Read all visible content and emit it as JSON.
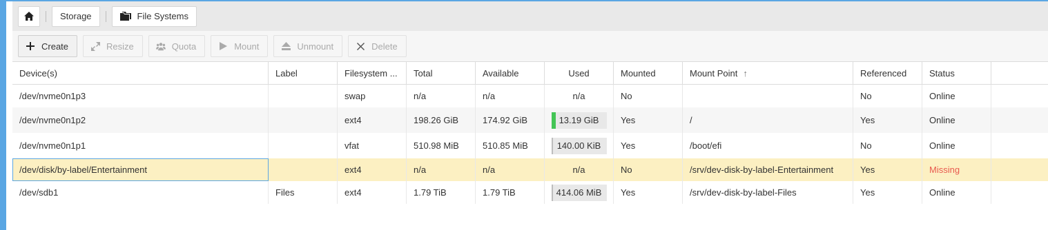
{
  "colors": {
    "accent": "#5aa6e3",
    "used_fill": "#44c556",
    "missing": "#e85a4f",
    "selected_row": "#fcf0c2"
  },
  "breadcrumb": {
    "home_icon": "home-icon",
    "items": [
      {
        "label": "Storage"
      },
      {
        "label": "File Systems",
        "icon": "folders-icon"
      }
    ]
  },
  "toolbar": {
    "buttons": [
      {
        "label": "Create",
        "icon": "plus-icon",
        "enabled": true
      },
      {
        "label": "Resize",
        "icon": "expand-icon",
        "enabled": false
      },
      {
        "label": "Quota",
        "icon": "users-icon",
        "enabled": false
      },
      {
        "label": "Mount",
        "icon": "play-icon",
        "enabled": false
      },
      {
        "label": "Unmount",
        "icon": "eject-icon",
        "enabled": false
      },
      {
        "label": "Delete",
        "icon": "x-icon",
        "enabled": false
      }
    ]
  },
  "table": {
    "columns": [
      "Device(s)",
      "Label",
      "Filesystem ...",
      "Total",
      "Available",
      "Used",
      "Mounted",
      "Mount Point",
      "Referenced",
      "Status"
    ],
    "sort_column": "Mount Point",
    "sort_direction": "ascending",
    "rows": [
      {
        "device": "/dev/nvme0n1p3",
        "label": "",
        "fs": "swap",
        "total": "n/a",
        "available": "n/a",
        "used": "n/a",
        "used_fraction": null,
        "mounted": "No",
        "mount_point": "",
        "referenced": "No",
        "status": "Online"
      },
      {
        "device": "/dev/nvme0n1p2",
        "label": "",
        "fs": "ext4",
        "total": "198.26 GiB",
        "available": "174.92 GiB",
        "used": "13.19 GiB",
        "used_fraction": 0.07,
        "mounted": "Yes",
        "mount_point": "/",
        "referenced": "Yes",
        "status": "Online"
      },
      {
        "device": "/dev/nvme0n1p1",
        "label": "",
        "fs": "vfat",
        "total": "510.98 MiB",
        "available": "510.85 MiB",
        "used": "140.00 KiB",
        "used_fraction": 0.0003,
        "mounted": "Yes",
        "mount_point": "/boot/efi",
        "referenced": "No",
        "status": "Online"
      },
      {
        "device": "/dev/disk/by-label/Entertainment",
        "label": "",
        "fs": "ext4",
        "total": "n/a",
        "available": "n/a",
        "used": "n/a",
        "used_fraction": null,
        "mounted": "No",
        "mount_point": "/srv/dev-disk-by-label-Entertainment",
        "referenced": "Yes",
        "status": "Missing",
        "selected": true
      },
      {
        "device": "/dev/sdb1",
        "label": "Files",
        "fs": "ext4",
        "total": "1.79 TiB",
        "available": "1.79 TiB",
        "used": "414.06 MiB",
        "used_fraction": 0.0002,
        "mounted": "Yes",
        "mount_point": "/srv/dev-disk-by-label-Files",
        "referenced": "Yes",
        "status": "Online"
      }
    ]
  }
}
